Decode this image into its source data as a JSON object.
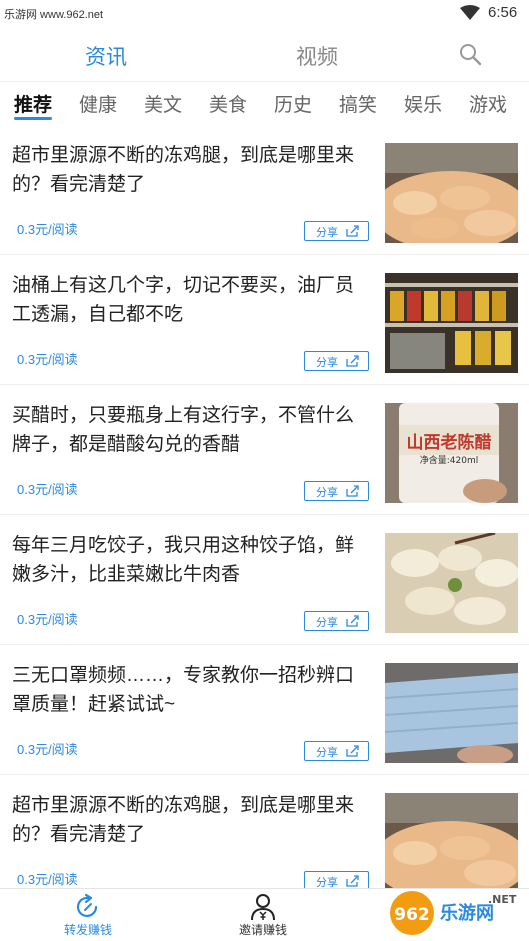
{
  "status_bar": {
    "carrier": "乐游网 www.962.net",
    "time": "6:56"
  },
  "top_nav": {
    "tabs": [
      "资讯",
      "视频"
    ],
    "active_tab": "资讯",
    "search_icon": "search-icon"
  },
  "categories": [
    "推荐",
    "健康",
    "美文",
    "美食",
    "历史",
    "搞笑",
    "娱乐",
    "游戏"
  ],
  "active_category": "推荐",
  "feed": [
    {
      "title": "超市里源源不断的冻鸡腿，到底是哪里来的？看完清楚了",
      "price": "0.3元/阅读",
      "share_label": "分享",
      "image": "frozen-chicken-legs"
    },
    {
      "title": "油桶上有这几个字，切记不要买，油厂员工透漏，自己都不吃",
      "price": "0.3元/阅读",
      "share_label": "分享",
      "image": "oil-shelves"
    },
    {
      "title": "买醋时，只要瓶身上有这行字，不管什么牌子，都是醋酸勾兑的香醋",
      "price": "0.3元/阅读",
      "share_label": "分享",
      "image": "vinegar-bottle",
      "image_label": "山西老陈醋",
      "image_sub": "净含量:420ml"
    },
    {
      "title": "每年三月吃饺子，我只用这种饺子馅，鲜嫩多汁，比韭菜嫩比牛肉香",
      "price": "0.3元/阅读",
      "share_label": "分享",
      "image": "dumplings"
    },
    {
      "title": "三无口罩频频……，专家教你一招秒辨口罩质量！赶紧试试~",
      "price": "0.3元/阅读",
      "share_label": "分享",
      "image": "face-masks"
    },
    {
      "title": "超市里源源不断的冻鸡腿，到底是哪里来的？看完清楚了",
      "price": "0.3元/阅读",
      "share_label": "分享",
      "image": "frozen-chicken-legs"
    }
  ],
  "bottom_bar": {
    "items": [
      "转发赚钱",
      "邀请赚钱"
    ]
  },
  "watermark": {
    "line1": "962",
    "line2": "乐游网",
    "line3": ".NET"
  },
  "colors": {
    "accent": "#2b8ae0",
    "text": "#222222",
    "muted": "#888888"
  }
}
